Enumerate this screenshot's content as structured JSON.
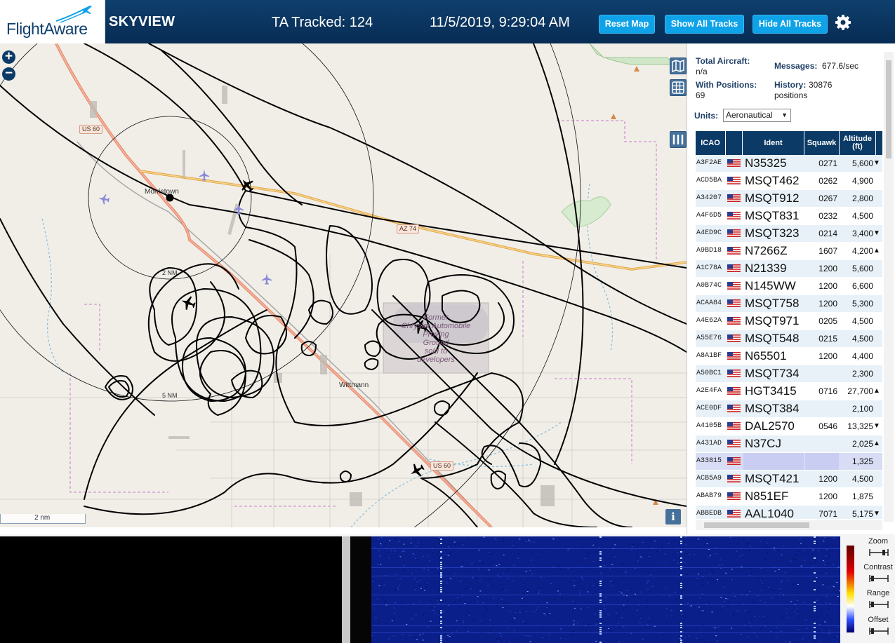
{
  "header": {
    "logo_text": "FlightAware",
    "app_title": "SKYVIEW",
    "tracked_label": "TA Tracked: 124",
    "datetime": "11/5/2019, 9:29:04 AM",
    "buttons": {
      "reset": "Reset Map",
      "show_all": "Show All Tracks",
      "hide_all": "Hide All Tracks"
    },
    "settings_icon": "gear-icon"
  },
  "map": {
    "zoom_in": "+",
    "zoom_out": "−",
    "scale_label": "2 nm",
    "ring_labels": [
      "2 NM",
      "5 NM"
    ],
    "places": [
      "Morristown",
      "Wittmann"
    ],
    "roads": [
      "US 60",
      "AZ 74",
      "US 60"
    ],
    "area_label": [
      "Former",
      "Chrysler Automobile",
      "Proving",
      "Ground",
      "sold to",
      "developers"
    ],
    "info_button": "i",
    "colors": {
      "land": "#f1eee8",
      "track": "#000000",
      "highway": "#f0a070"
    }
  },
  "stats": {
    "total_aircraft_label": "Total Aircraft:",
    "total_aircraft_value": "n/a",
    "with_positions_label": "With Positions:",
    "with_positions_value": "69",
    "messages_label": "Messages:",
    "messages_value": "677.6/sec",
    "history_label": "History:",
    "history_value": "30876",
    "history_unit": "positions"
  },
  "units": {
    "label": "Units:",
    "selected": "Aeronautical"
  },
  "table": {
    "columns": [
      "ICAO",
      "",
      "Ident",
      "Squawk",
      "Altitude (ft)"
    ],
    "rows": [
      {
        "icao": "A3F2AE",
        "ident": "N35325",
        "squawk": "0271",
        "alt": "5,600",
        "trend": "▼"
      },
      {
        "icao": "ACD5BA",
        "ident": "MSQT462",
        "squawk": "0262",
        "alt": "4,900",
        "trend": ""
      },
      {
        "icao": "A34207",
        "ident": "MSQT912",
        "squawk": "0267",
        "alt": "2,800",
        "trend": ""
      },
      {
        "icao": "A4F6D5",
        "ident": "MSQT831",
        "squawk": "0232",
        "alt": "4,500",
        "trend": ""
      },
      {
        "icao": "A4ED9C",
        "ident": "MSQT323",
        "squawk": "0214",
        "alt": "3,400",
        "trend": "▼"
      },
      {
        "icao": "A9BD18",
        "ident": "N7266Z",
        "squawk": "1607",
        "alt": "4,200",
        "trend": "▲"
      },
      {
        "icao": "A1C78A",
        "ident": "N21339",
        "squawk": "1200",
        "alt": "5,600",
        "trend": ""
      },
      {
        "icao": "A0B74C",
        "ident": "N145WW",
        "squawk": "1200",
        "alt": "6,600",
        "trend": ""
      },
      {
        "icao": "ACAA84",
        "ident": "MSQT758",
        "squawk": "1200",
        "alt": "5,300",
        "trend": ""
      },
      {
        "icao": "A4E62A",
        "ident": "MSQT971",
        "squawk": "0205",
        "alt": "4,500",
        "trend": ""
      },
      {
        "icao": "A55E76",
        "ident": "MSQT548",
        "squawk": "0215",
        "alt": "4,500",
        "trend": ""
      },
      {
        "icao": "A8A1BF",
        "ident": "N65501",
        "squawk": "1200",
        "alt": "4,400",
        "trend": ""
      },
      {
        "icao": "A50BC1",
        "ident": "MSQT734",
        "squawk": "",
        "alt": "2,300",
        "trend": ""
      },
      {
        "icao": "A2E4FA",
        "ident": "HGT3415",
        "squawk": "0716",
        "alt": "27,700",
        "trend": "▲"
      },
      {
        "icao": "ACE0DF",
        "ident": "MSQT384",
        "squawk": "",
        "alt": "2,100",
        "trend": ""
      },
      {
        "icao": "A4105B",
        "ident": "DAL2570",
        "squawk": "0546",
        "alt": "13,325",
        "trend": "▼"
      },
      {
        "icao": "A431AD",
        "ident": "N37CJ",
        "squawk": "",
        "alt": "2,025",
        "trend": "▲"
      },
      {
        "icao": "A33815",
        "ident": "",
        "squawk": "",
        "alt": "1,325",
        "trend": "",
        "selected": true
      },
      {
        "icao": "ACB5A9",
        "ident": "MSQT421",
        "squawk": "1200",
        "alt": "4,500",
        "trend": ""
      },
      {
        "icao": "ABAB79",
        "ident": "N851EF",
        "squawk": "1200",
        "alt": "1,875",
        "trend": ""
      },
      {
        "icao": "ABBEDB",
        "ident": "AAL1040",
        "squawk": "7071",
        "alt": "5,175",
        "trend": "▼"
      }
    ]
  },
  "spectrum": {
    "controls": [
      "Zoom",
      "Contrast",
      "Range",
      "Offset"
    ]
  }
}
